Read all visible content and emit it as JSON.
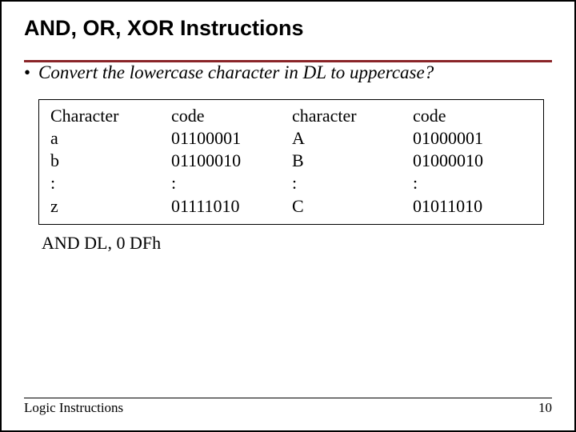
{
  "title": "AND, OR, XOR Instructions",
  "bullet": "Convert the lowercase character in DL to uppercase?",
  "table": {
    "headers": {
      "h1": "Character",
      "h2": "code",
      "h3": "character",
      "h4": "code"
    },
    "rows": {
      "r1": {
        "c1": "a",
        "c2": "01100001",
        "c3": "A",
        "c4": "01000001"
      },
      "r2": {
        "c1": "b",
        "c2": "01100010",
        "c3": "B",
        "c4": "01000010"
      },
      "r3": {
        "c1": ":",
        "c2": ":",
        "c3": ":",
        "c4": ":"
      },
      "r4": {
        "c1": "z",
        "c2": "01111010",
        "c3": "C",
        "c4": "01011010"
      }
    }
  },
  "instruction": "AND DL, 0 DFh",
  "footer": {
    "left": "Logic Instructions",
    "right": "10"
  }
}
